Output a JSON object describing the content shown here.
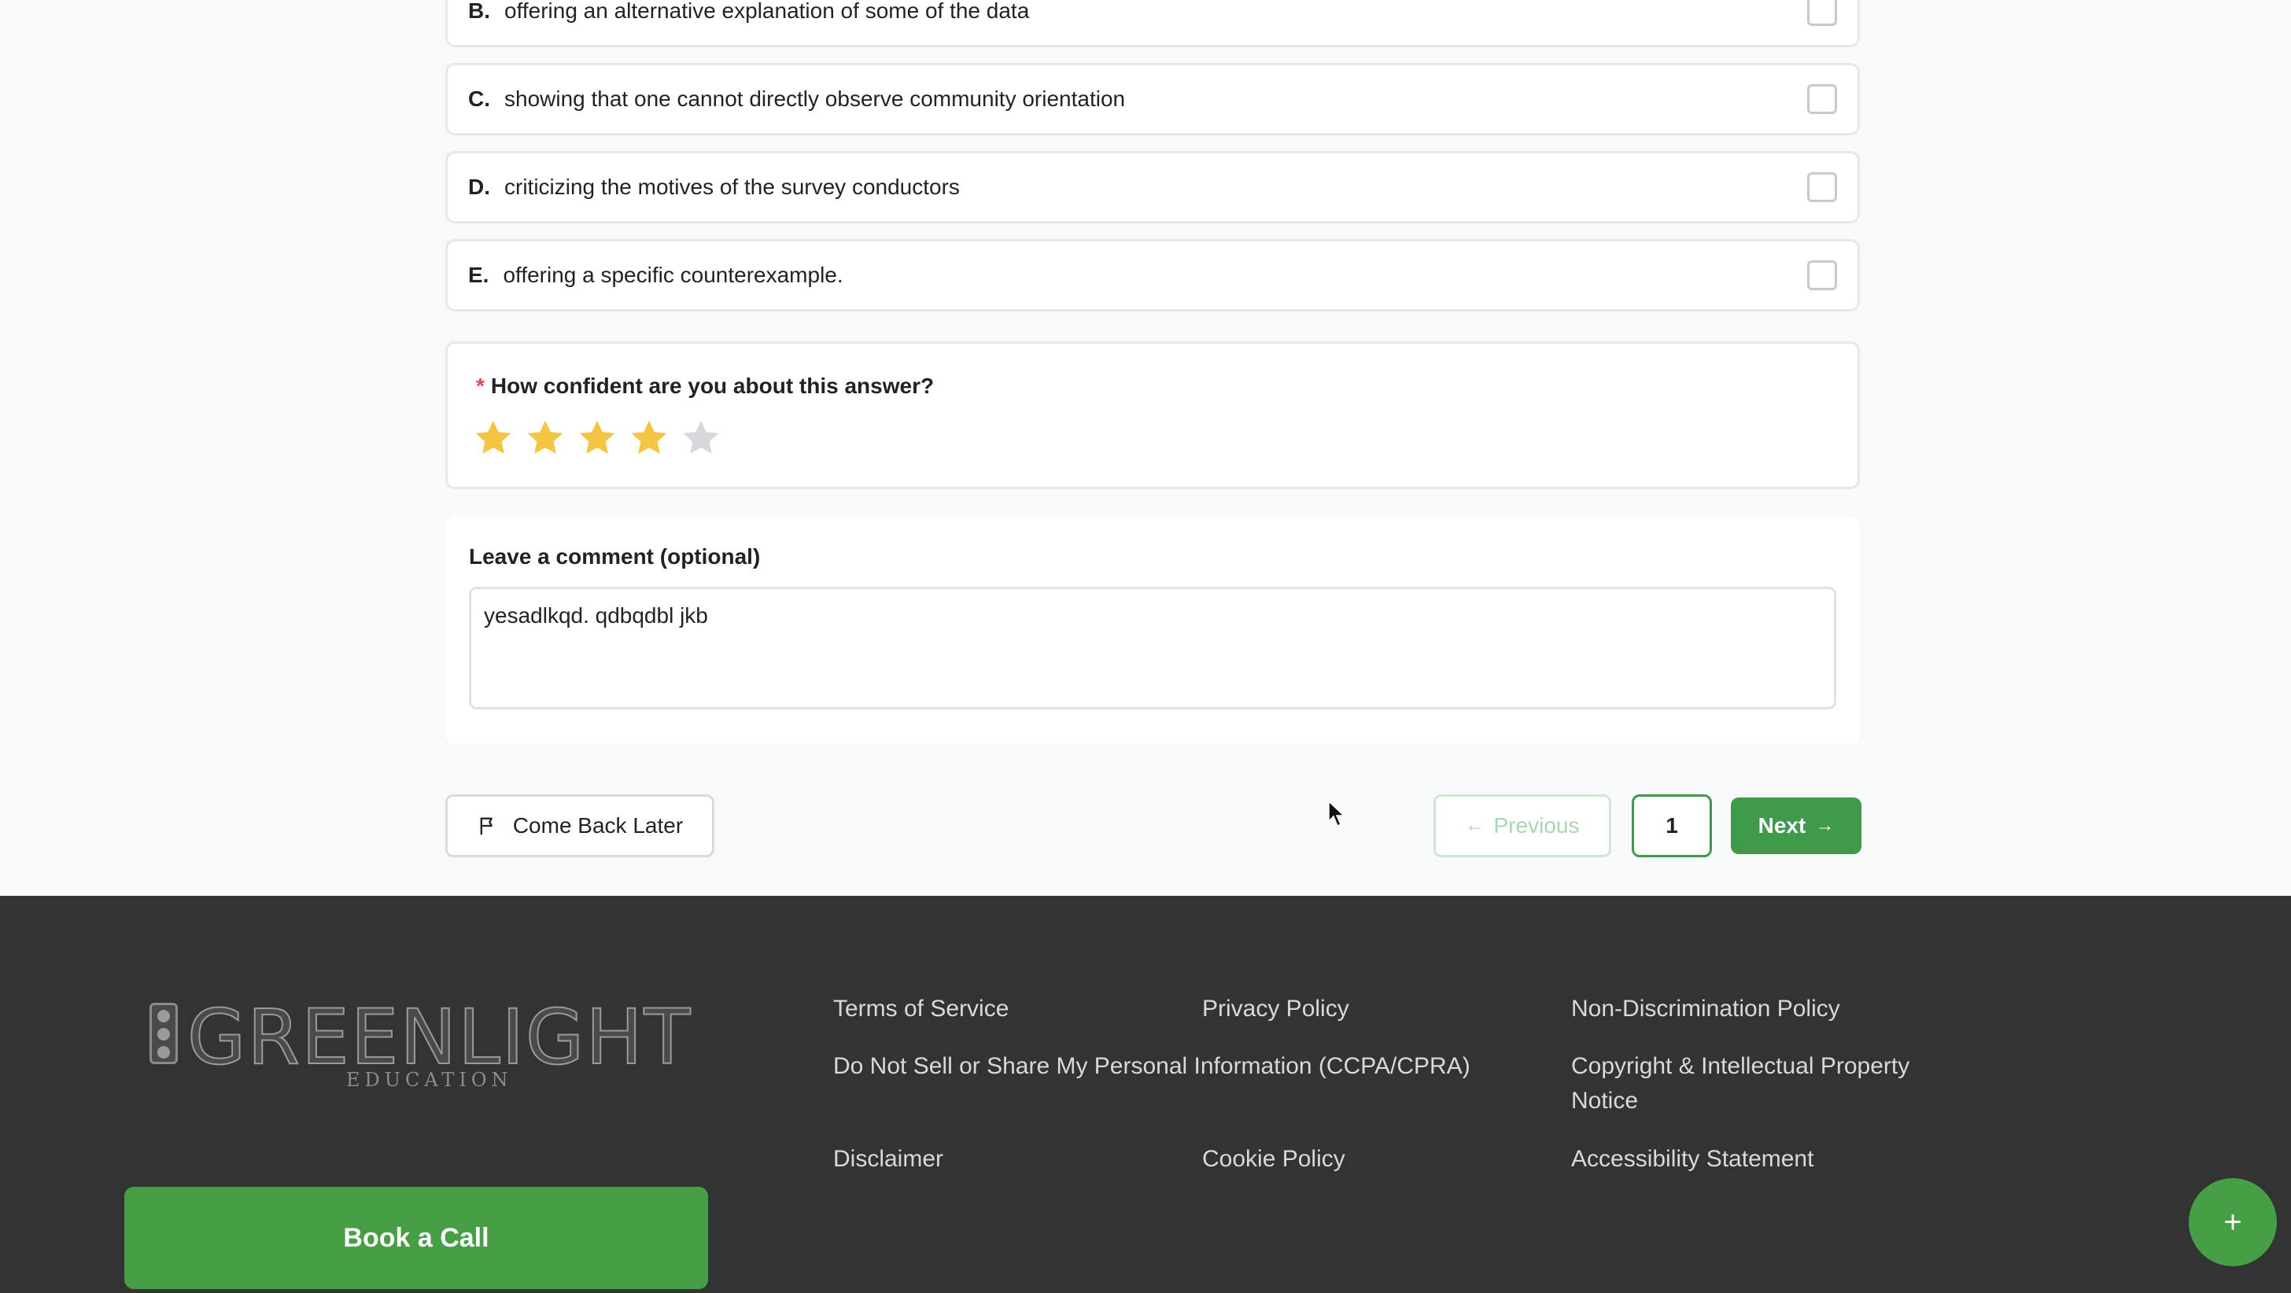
{
  "options": [
    {
      "letter": "B.",
      "text": "offering an alternative explanation of some of the data"
    },
    {
      "letter": "C.",
      "text": "showing that one cannot directly observe community orientation"
    },
    {
      "letter": "D.",
      "text": "criticizing the motives of the survey conductors"
    },
    {
      "letter": "E.",
      "text": "offering a specific counterexample."
    }
  ],
  "confidence": {
    "required_mark": "*",
    "question": "How confident are you about this answer?",
    "rating": 4,
    "max_rating": 5,
    "star_color": "#f5c542",
    "star_empty_color": "#d6d8dc"
  },
  "comment": {
    "label": "Leave a comment (optional)",
    "value": "yesadlkqd. qdbqdbl jkb"
  },
  "nav": {
    "come_back_label": "Come Back Later",
    "previous_label": "Previous",
    "page_number": "1",
    "next_label": "Next"
  },
  "footer": {
    "logo_text": "GREENLIGHT",
    "logo_sub": "EDUCATION",
    "links": [
      "Terms of Service",
      "Privacy Policy",
      "Non-Discrimination Policy",
      "Do Not Sell or Share My Personal Information (CCPA/CPRA)",
      "Copyright & Intellectual Property Notice",
      "Disclaimer",
      "Cookie Policy",
      "Accessibility Statement"
    ],
    "book_call_label": "Book a Call",
    "fab_label": "+"
  },
  "colors": {
    "accent": "#3f9a4c",
    "footer_bg": "#333333"
  }
}
